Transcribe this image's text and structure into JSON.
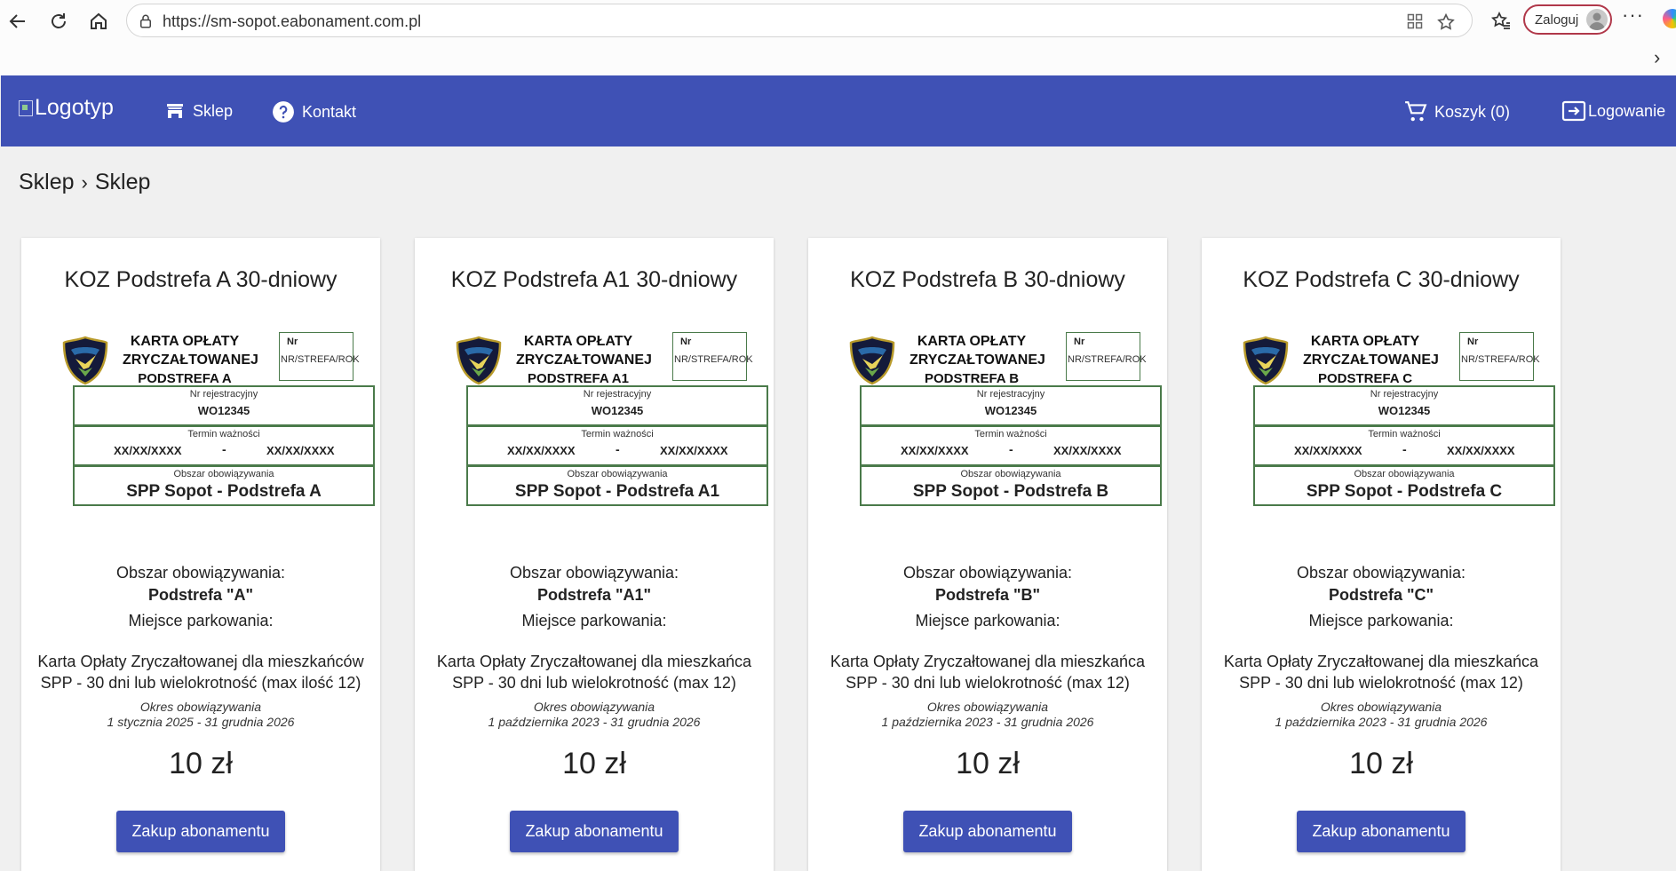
{
  "browser": {
    "url": "https://sm-sopot.eabonament.com.pl",
    "signin_label": "Zaloguj"
  },
  "header": {
    "logo_alt": "Logotyp",
    "nav": [
      {
        "label": "Sklep",
        "icon": "store-icon"
      },
      {
        "label": "Kontakt",
        "icon": "help-circle-icon"
      }
    ],
    "cart_label": "Koszyk (0)",
    "login_label": "Logowanie",
    "colors": {
      "primary": "#3f51b5"
    }
  },
  "breadcrumb": [
    "Sklep",
    "Sklep"
  ],
  "products": [
    {
      "title": "KOZ Podstrefa A 30-dniowy",
      "ticket": {
        "line1": "KARTA OPŁATY",
        "line2": "ZRYCZAŁTOWANEJ",
        "line3": "PODSTREFA A",
        "nr_label": "Nr",
        "nr_value": "NR/STREFA/ROK",
        "reg_label": "Nr rejestracyjny",
        "reg_value": "WO12345",
        "term_label": "Termin ważności",
        "date_from": "XX/XX/XXXX",
        "date_sep": "-",
        "date_to": "XX/XX/XXXX",
        "area_label": "Obszar obowiązywania",
        "area_value": "SPP Sopot - Podstrefa A"
      },
      "area_label": "Obszar obowiązywania:",
      "area_value": "Podstrefa \"A\"",
      "place_label": "Miejsce parkowania:",
      "description_line1": "Karta Opłaty Zryczałtowanej dla mieszkańców",
      "description_line2": "SPP - 30 dni lub wielokrotność (max ilość 12)",
      "period_label": "Okres obowiązywania",
      "period_value": "1 stycznia 2025 - 31 grudnia 2026",
      "price": "10 zł",
      "button_label": "Zakup abonamentu"
    },
    {
      "title": "KOZ Podstrefa A1 30-dniowy",
      "ticket": {
        "line1": "KARTA OPŁATY",
        "line2": "ZRYCZAŁTOWANEJ",
        "line3": "PODSTREFA A1",
        "nr_label": "Nr",
        "nr_value": "NR/STREFA/ROK",
        "reg_label": "Nr rejestracyjny",
        "reg_value": "WO12345",
        "term_label": "Termin ważności",
        "date_from": "XX/XX/XXXX",
        "date_sep": "-",
        "date_to": "XX/XX/XXXX",
        "area_label": "Obszar obowiązywania",
        "area_value": "SPP Sopot - Podstrefa A1"
      },
      "area_label": "Obszar obowiązywania:",
      "area_value": "Podstrefa \"A1\"",
      "place_label": "Miejsce parkowania:",
      "description_line1": "Karta Opłaty Zryczałtowanej dla mieszkańca",
      "description_line2": "SPP - 30 dni lub wielokrotność (max 12)",
      "period_label": "Okres obowiązywania",
      "period_value": "1 października 2023 - 31 grudnia 2026",
      "price": "10 zł",
      "button_label": "Zakup abonamentu"
    },
    {
      "title": "KOZ Podstrefa B 30-dniowy",
      "ticket": {
        "line1": "KARTA OPŁATY",
        "line2": "ZRYCZAŁTOWANEJ",
        "line3": "PODSTREFA B",
        "nr_label": "Nr",
        "nr_value": "NR/STREFA/ROK",
        "reg_label": "Nr rejestracyjny",
        "reg_value": "WO12345",
        "term_label": "Termin ważności",
        "date_from": "XX/XX/XXXX",
        "date_sep": "-",
        "date_to": "XX/XX/XXXX",
        "area_label": "Obszar obowiązywania",
        "area_value": "SPP Sopot - Podstrefa B"
      },
      "area_label": "Obszar obowiązywania:",
      "area_value": "Podstrefa \"B\"",
      "place_label": "Miejsce parkowania:",
      "description_line1": "Karta Opłaty Zryczałtowanej dla mieszkańca",
      "description_line2": "SPP - 30 dni lub wielokrotność (max 12)",
      "period_label": "Okres obowiązywania",
      "period_value": "1 października 2023 - 31 grudnia 2026",
      "price": "10 zł",
      "button_label": "Zakup abonamentu"
    },
    {
      "title": "KOZ Podstrefa C 30-dniowy",
      "ticket": {
        "line1": "KARTA OPŁATY",
        "line2": "ZRYCZAŁTOWANEJ",
        "line3": "PODSTREFA C",
        "nr_label": "Nr",
        "nr_value": "NR/STREFA/ROK",
        "reg_label": "Nr rejestracyjny",
        "reg_value": "WO12345",
        "term_label": "Termin ważności",
        "date_from": "XX/XX/XXXX",
        "date_sep": "-",
        "date_to": "XX/XX/XXXX",
        "area_label": "Obszar obowiązywania",
        "area_value": "SPP Sopot - Podstrefa C"
      },
      "area_label": "Obszar obowiązywania:",
      "area_value": "Podstrefa \"C\"",
      "place_label": "Miejsce parkowania:",
      "description_line1": "Karta Opłaty Zryczałtowanej dla mieszkańca",
      "description_line2": "SPP - 30 dni lub wielokrotność (max 12)",
      "period_label": "Okres obowiązywania",
      "period_value": "1 października 2023 - 31 grudnia 2026",
      "price": "10 zł",
      "button_label": "Zakup abonamentu"
    }
  ]
}
